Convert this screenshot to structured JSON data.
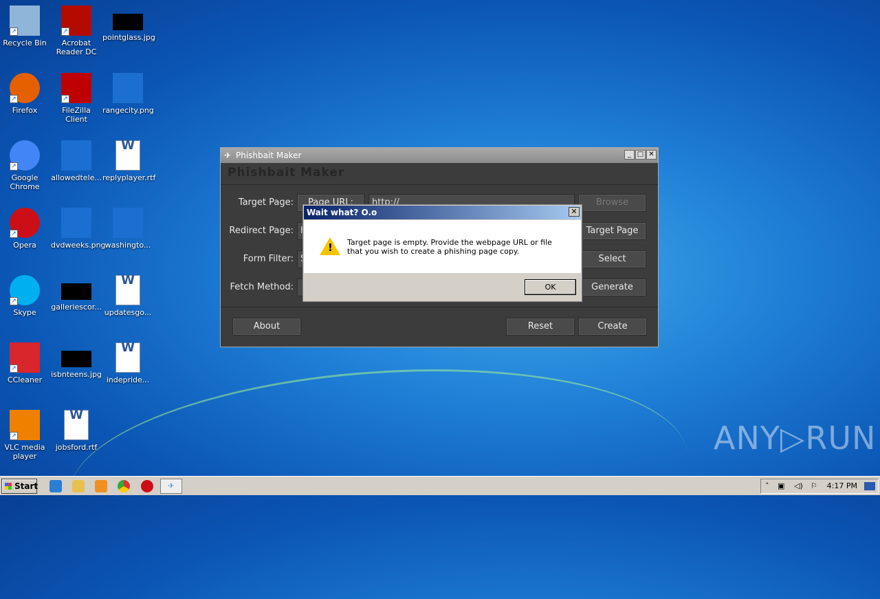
{
  "desktop": {
    "icons": [
      {
        "label": "Recycle Bin",
        "icon": "recycle-bin-icon",
        "color": "#8fb5d8"
      },
      {
        "label": "Acrobat Reader DC",
        "icon": "acrobat-icon",
        "color": "#b30b00"
      },
      {
        "label": "pointglass.jpg",
        "icon": "image-file-icon",
        "color": "#000000"
      },
      {
        "label": "Firefox",
        "icon": "firefox-icon",
        "color": "#e66000"
      },
      {
        "label": "FileZilla Client",
        "icon": "filezilla-icon",
        "color": "#bf0000"
      },
      {
        "label": "rangecity.png",
        "icon": "image-file-icon",
        "color": "#1a6fd0"
      },
      {
        "label": "Google Chrome",
        "icon": "chrome-icon",
        "color": "#4285f4"
      },
      {
        "label": "allowedtele...",
        "icon": "file-icon",
        "color": "#1a6fd0"
      },
      {
        "label": "replyplayer.rtf",
        "icon": "word-doc-icon",
        "color": "#ffffff"
      },
      {
        "label": "Opera",
        "icon": "opera-icon",
        "color": "#cc0f16"
      },
      {
        "label": "dvdweeks.png",
        "icon": "image-file-icon",
        "color": "#1a6fd0"
      },
      {
        "label": "washingto...",
        "icon": "image-file-icon",
        "color": "#1a6fd0"
      },
      {
        "label": "Skype",
        "icon": "skype-icon",
        "color": "#00aff0"
      },
      {
        "label": "galleriescor...",
        "icon": "image-file-icon",
        "color": "#000000"
      },
      {
        "label": "updatesgo...",
        "icon": "word-doc-icon",
        "color": "#ffffff"
      },
      {
        "label": "CCleaner",
        "icon": "ccleaner-icon",
        "color": "#d8262c"
      },
      {
        "label": "isbnteens.jpg",
        "icon": "image-file-icon",
        "color": "#000000"
      },
      {
        "label": "indepride...",
        "icon": "word-doc-icon",
        "color": "#ffffff"
      },
      {
        "label": "VLC media player",
        "icon": "vlc-icon",
        "color": "#f08000"
      },
      {
        "label": "jobsford.rtf",
        "icon": "word-doc-icon",
        "color": "#ffffff"
      }
    ]
  },
  "app": {
    "window_title": "Phishbait Maker",
    "header": "Phishbait Maker",
    "labels": {
      "target": "Target Page:",
      "redirect": "Redirect Page:",
      "filter": "Form Filter:",
      "fetch": "Fetch Method:"
    },
    "page_url_button": "Page URL:",
    "target_url_value": "http://",
    "redirect_value": "h",
    "filter_value": "S",
    "buttons": {
      "browse": "Browse",
      "target_page": "Target Page",
      "select": "Select",
      "generate": "Generate",
      "about": "About",
      "reset": "Reset",
      "create": "Create"
    }
  },
  "dialog": {
    "title": "Wait what? O.o",
    "message": "Target page is empty. Provide the webpage URL or file that you wish to create a phishing page copy.",
    "ok": "OK",
    "close": "✕"
  },
  "taskbar": {
    "start": "Start",
    "clock": "4:17 PM"
  },
  "watermark": "ANY▷RUN"
}
